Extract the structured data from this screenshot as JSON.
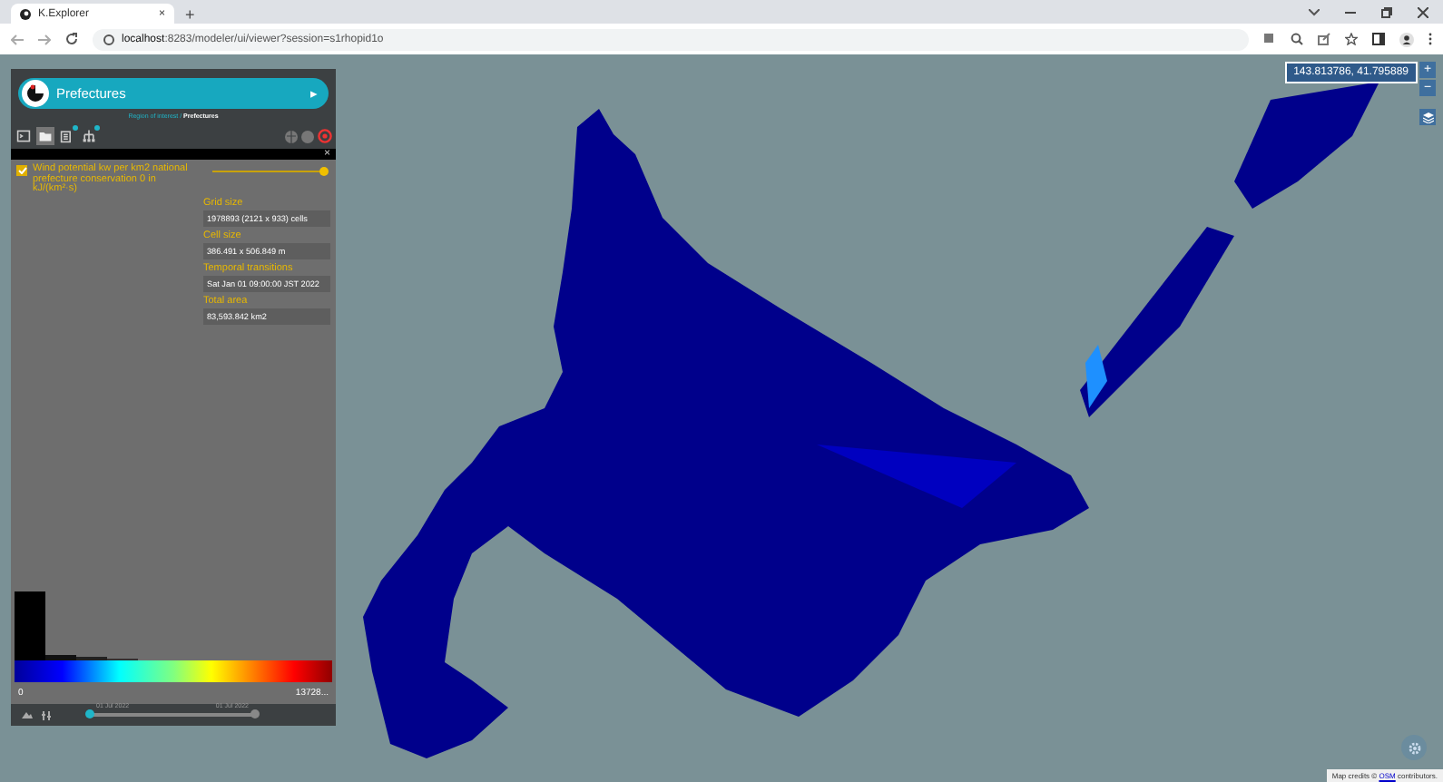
{
  "browser": {
    "tab_title": "K.Explorer",
    "tab_close": "×",
    "new_tab": "+",
    "url": "**localhost**:8283/modeler/ui/viewer?session=s1rhopid1o"
  },
  "panel": {
    "title": "Prefectures",
    "title_arrow": "▸",
    "breadcrumb": "Region of interest / **Prefectures**",
    "tools": [
      {
        "kind": "terminal",
        "selected": false,
        "badge": false
      },
      {
        "kind": "folder",
        "selected": true,
        "badge": false
      },
      {
        "kind": "layers",
        "selected": false,
        "badge": true
      },
      {
        "kind": "tree",
        "selected": false,
        "badge": true
      }
    ],
    "close": "×",
    "layer": {
      "name": "Wind potential kw per km2 national prefecture conservation 0 in kJ/(km²·s)",
      "checked": true,
      "level": 1.0
    },
    "info": [
      {
        "label": "Grid size",
        "value": "1978893 (2121 x 933) cells"
      },
      {
        "label": "Cell size",
        "value": "386.491 x 506.849 m"
      },
      {
        "label": "Temporal transitions",
        "value": "Sat Jan 01 09:00:00 JST 2022"
      },
      {
        "label": "Total area",
        "value": "83,593.842 km2"
      }
    ],
    "legend": {
      "min": "0",
      "max": "13728..."
    },
    "timeline": {
      "start": "01 Jul 2022",
      "end": "01 Jul 2022",
      "level": 1.0
    }
  },
  "map": {
    "coordinates": "143.813786, 41.795889",
    "zoom_in": "+",
    "zoom_out": "−",
    "credits": "Map credits ©",
    "credits_link": "OSM",
    "credits_suffix": "contributors."
  }
}
